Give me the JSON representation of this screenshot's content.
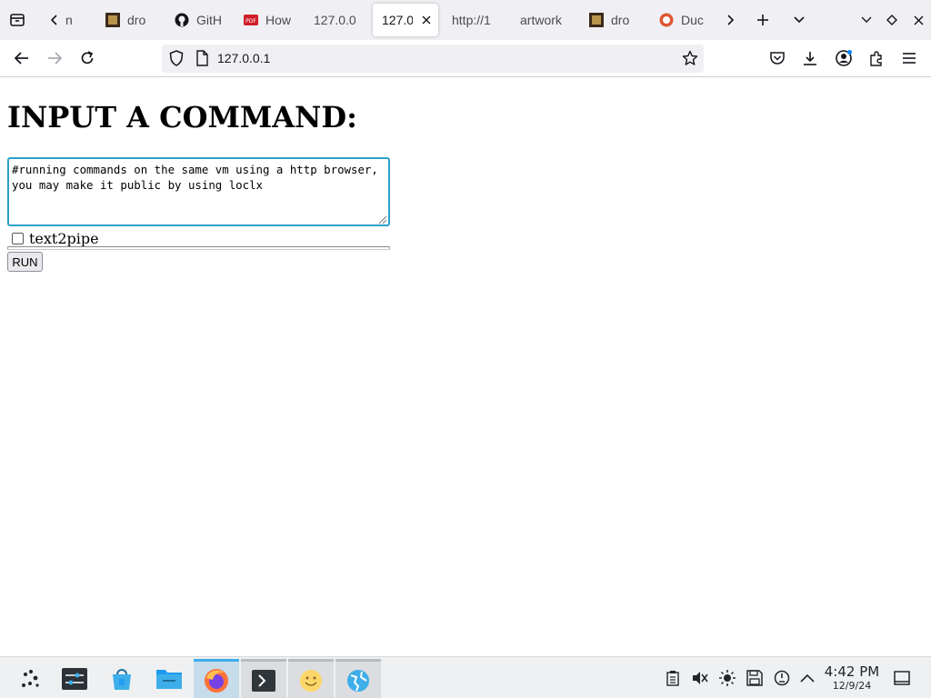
{
  "browser": {
    "tabs": [
      {
        "label": "n",
        "favicon": "arrow-icon"
      },
      {
        "label": "dro",
        "favicon": "droid-icon"
      },
      {
        "label": "GitH",
        "favicon": "github-icon"
      },
      {
        "label": "How",
        "favicon": "pdf-icon"
      },
      {
        "label": "127.0.0",
        "favicon": ""
      },
      {
        "label": "127.0",
        "favicon": "",
        "active": true
      },
      {
        "label": "http://1",
        "favicon": ""
      },
      {
        "label": "artwork",
        "favicon": ""
      },
      {
        "label": "dro",
        "favicon": "droid-icon"
      },
      {
        "label": "Duc",
        "favicon": "duckduckgo-icon"
      }
    ],
    "url": "127.0.0.1",
    "accent_color": "#2ba0cc"
  },
  "page": {
    "heading": "INPUT A COMMAND:",
    "textarea_value": "#running commands on the same vm using a http browser,\nyou may make it public by using loclx",
    "checkbox_label": "text2pipe",
    "run_label": "RUN"
  },
  "taskbar": {
    "time": "4:42 PM",
    "date": "12/9/24"
  }
}
